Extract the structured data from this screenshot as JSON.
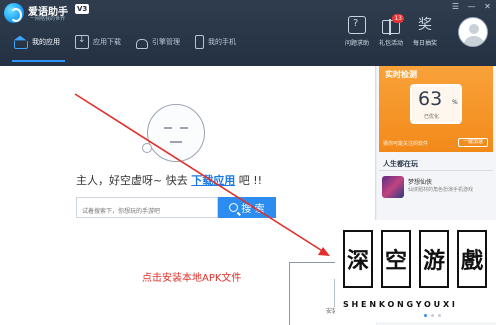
{
  "app": {
    "name": "爱语助手",
    "version": "V3",
    "slogan": "一网络我的世界"
  },
  "window_controls": [
    "☰",
    "—",
    "✕"
  ],
  "nav": {
    "tabs": [
      {
        "label": "我的应用",
        "icon": "home-icon",
        "active": true
      },
      {
        "label": "应用下载",
        "icon": "download-icon",
        "active": false
      },
      {
        "label": "引擎管理",
        "icon": "android-icon",
        "active": false
      },
      {
        "label": "我的手机",
        "icon": "phone-icon",
        "active": false
      }
    ]
  },
  "toolbar": {
    "help_label": "问题求助",
    "gift_label": "礼包活动",
    "gift_badge": "13",
    "daily_label": "每日抽奖",
    "daily_glyph": "奖"
  },
  "main": {
    "empty_text_before": "主人，好空虚呀~ 快去 ",
    "empty_link": "下载应用",
    "empty_text_after": " 吧 !!",
    "search_placeholder": "试着搜索下，你想玩的手游吧",
    "search_button": "搜 索",
    "install_instruction": "点击安装本地APK文件",
    "install_button_label": "安装"
  },
  "side": {
    "realtime": {
      "title": "实时检测",
      "score": "63",
      "unit": "%",
      "sub": "已优化",
      "footer": "猜你可能关注的软件",
      "button": "一键加速"
    },
    "recommend": {
      "title": "人生都在玩",
      "game_name": "梦想仙侠",
      "game_desc": "仙侠题材的角色扮演手机游戏"
    }
  },
  "watermark": {
    "chars": [
      "深",
      "空",
      "游",
      "戲"
    ],
    "latin": "SHENKONGYOUXI"
  },
  "colors": {
    "topbar": "#243142",
    "accent": "#2d8cf0",
    "annotation": "#e0302b",
    "realtime_card": "#f28a1a"
  }
}
